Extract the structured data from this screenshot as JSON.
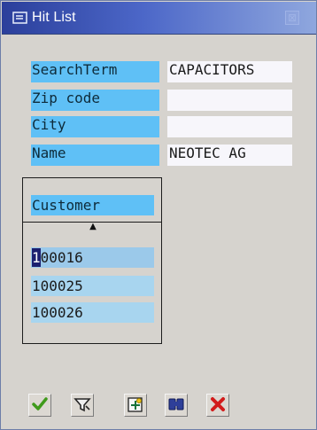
{
  "window": {
    "title": "Hit List",
    "title_icon": "hit-list-icon",
    "close_icon": "close-icon",
    "close_glyph": "⊠"
  },
  "fields": [
    {
      "label": "SearchTerm",
      "value": "CAPACITORS"
    },
    {
      "label": "Zip code",
      "value": ""
    },
    {
      "label": "City",
      "value": ""
    },
    {
      "label": "Name",
      "value": "NEOTEC AG"
    }
  ],
  "hitlist": {
    "column_header": "Customer",
    "sort_icon": "sort-ascending-icon",
    "rows": [
      {
        "value": "100016",
        "cursor_char": "1",
        "rest": "00016"
      },
      {
        "value": "100025"
      },
      {
        "value": "100026"
      }
    ]
  },
  "toolbar": {
    "buttons": [
      {
        "name": "continue-button",
        "icon": "checkmark-icon"
      },
      {
        "name": "restrictions-button",
        "icon": "filter-icon"
      },
      {
        "name": "new-search-button",
        "icon": "new-search-icon"
      },
      {
        "name": "find-button",
        "icon": "binoculars-icon"
      },
      {
        "name": "cancel-button",
        "icon": "cancel-icon"
      }
    ]
  },
  "colors": {
    "title_gradient_start": "#2b3f9b",
    "title_gradient_end": "#8fa7de",
    "label_blue": "#5fc0f6",
    "row_blue": "#a8d5ef",
    "dialog_gray": "#d6d3ce",
    "check_green": "#3f9a1b",
    "cancel_red": "#d21b1b"
  }
}
